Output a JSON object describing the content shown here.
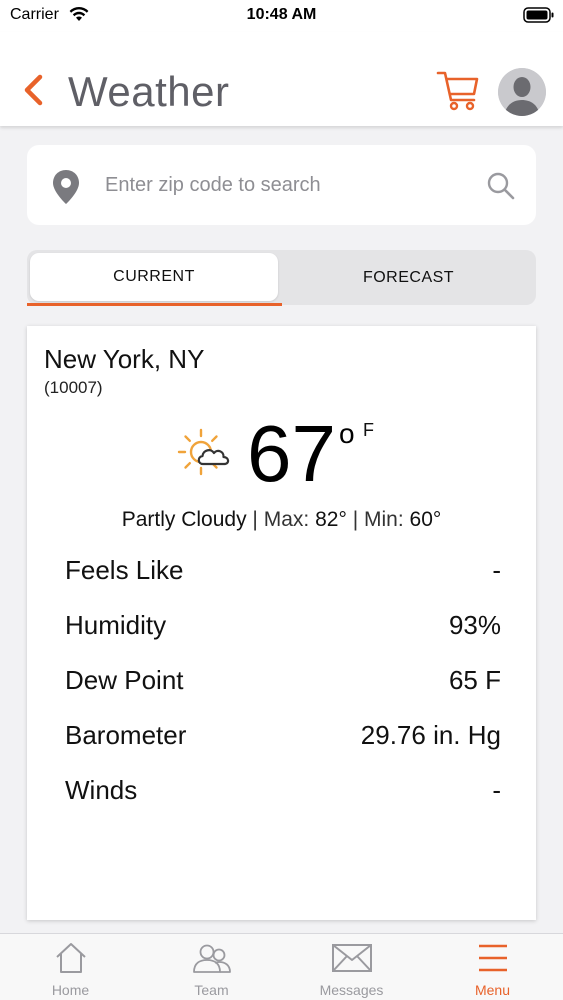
{
  "status_bar": {
    "carrier": "Carrier",
    "time": "10:48 AM"
  },
  "header": {
    "title": "Weather",
    "back_icon": "chevron-left-icon",
    "cart_icon": "cart-icon",
    "avatar_icon": "user-avatar-icon"
  },
  "search": {
    "placeholder": "Enter zip code to search",
    "value": ""
  },
  "tabs": [
    {
      "label": "CURRENT",
      "active": true
    },
    {
      "label": "FORECAST",
      "active": false
    }
  ],
  "weather": {
    "city": "New York, NY",
    "zip": "(10007)",
    "temperature": "67",
    "degree_symbol": "o",
    "unit": "F",
    "condition": "Partly Cloudy",
    "separator": "|",
    "max_label": "Max:",
    "max_value": "82°",
    "min_label": "Min:",
    "min_value": "60°",
    "icon": "partly-cloudy-icon"
  },
  "details": [
    {
      "label": "Feels Like",
      "value": "-"
    },
    {
      "label": "Humidity",
      "value": "93%"
    },
    {
      "label": "Dew Point",
      "value": "65 F"
    },
    {
      "label": "Barometer",
      "value": "29.76 in. Hg"
    },
    {
      "label": "Winds",
      "value": "-"
    }
  ],
  "tab_bar": [
    {
      "label": "Home",
      "icon": "home-icon",
      "active": false
    },
    {
      "label": "Team",
      "icon": "team-icon",
      "active": false
    },
    {
      "label": "Messages",
      "icon": "mail-icon",
      "active": false
    },
    {
      "label": "Menu",
      "icon": "menu-icon",
      "active": true
    }
  ],
  "colors": {
    "accent": "#e8622a",
    "inactive": "#9a9a9f"
  }
}
